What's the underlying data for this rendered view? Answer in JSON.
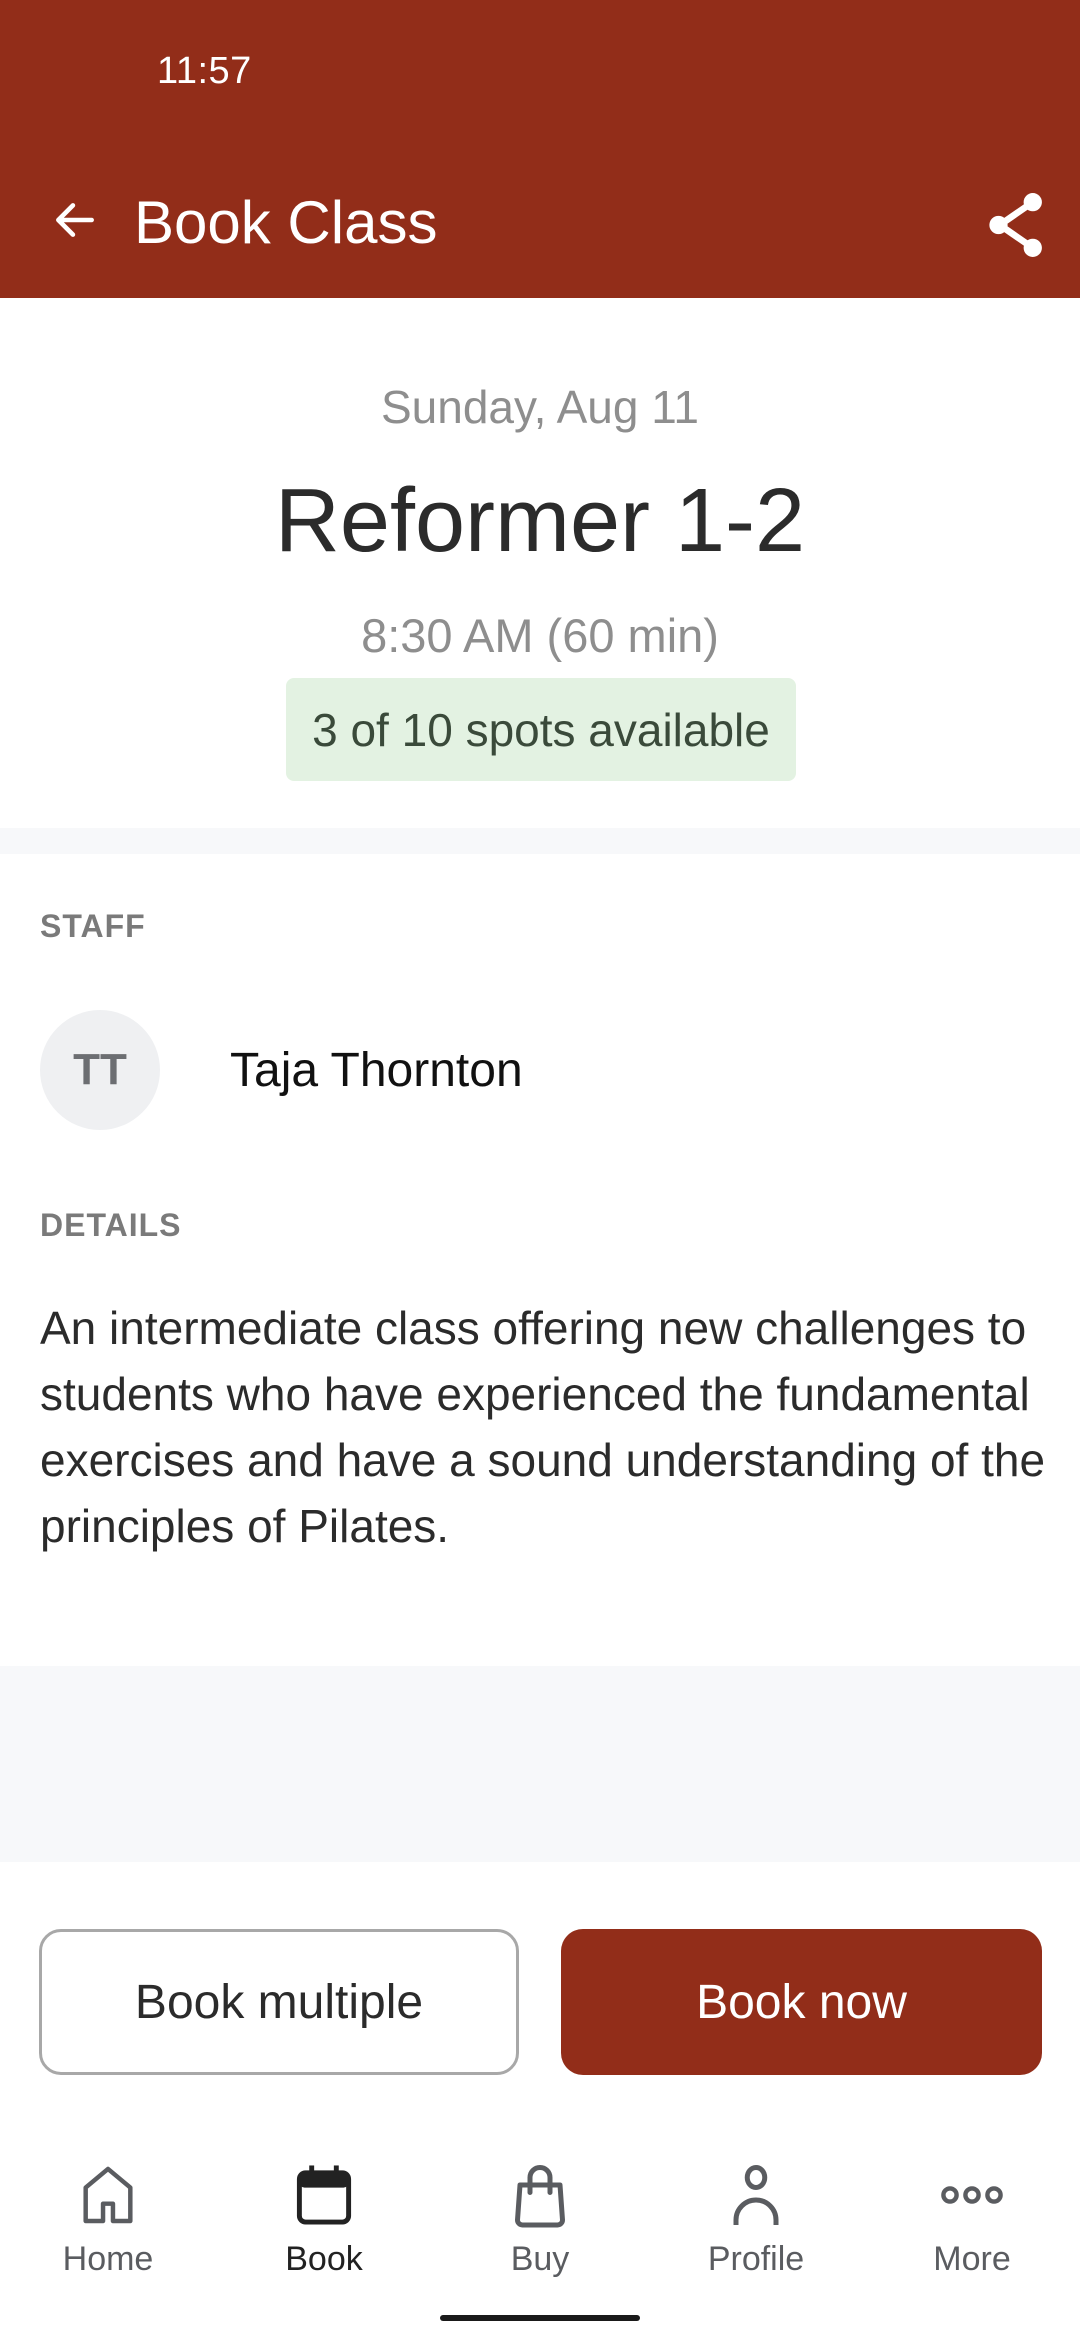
{
  "status_bar": {
    "time": "11:57"
  },
  "header": {
    "title": "Book Class",
    "back_icon": "arrow-left-icon",
    "share_icon": "share-icon",
    "color": "#922d19"
  },
  "class_info": {
    "date": "Sunday, Aug 11",
    "name": "Reformer 1-2",
    "time": "8:30 AM (60 min)",
    "availability": "3 of 10 spots available",
    "spots_available": 3,
    "spots_total": 10
  },
  "staff": {
    "label": "STAFF",
    "initials": "TT",
    "name": "Taja Thornton"
  },
  "details": {
    "label": "DETAILS",
    "text": "An intermediate class offering new challenges to students who have experienced the fundamental exercises and have a sound understanding of the principles of Pilates."
  },
  "actions": {
    "book_multiple": "Book multiple",
    "book_now": "Book now"
  },
  "bottom_nav": {
    "items": [
      {
        "label": "Home",
        "icon": "home-icon",
        "active": false
      },
      {
        "label": "Book",
        "icon": "calendar-icon",
        "active": true
      },
      {
        "label": "Buy",
        "icon": "shopping-bag-icon",
        "active": false
      },
      {
        "label": "Profile",
        "icon": "person-icon",
        "active": false
      },
      {
        "label": "More",
        "icon": "more-dots-icon",
        "active": false
      }
    ]
  }
}
